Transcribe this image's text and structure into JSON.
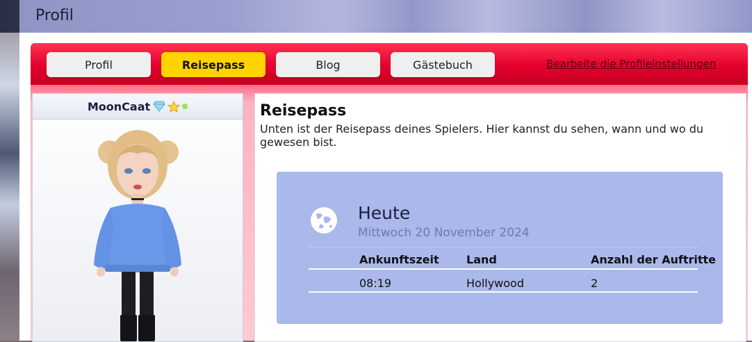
{
  "header": {
    "title": "Profil"
  },
  "nav": {
    "tabs": [
      {
        "label": "Profil",
        "active": false
      },
      {
        "label": "Reisepass",
        "active": true
      },
      {
        "label": "Blog",
        "active": false
      },
      {
        "label": "Gästebuch",
        "active": false
      }
    ],
    "edit_link": "Bearbeite die Profileinstellungen"
  },
  "avatar": {
    "username": "MoonCaat",
    "badges": [
      "diamond-icon",
      "star-icon",
      "online-status-icon"
    ]
  },
  "passport": {
    "title": "Reisepass",
    "description": "Unten ist der Reisepass deines Spielers. Hier kannst du sehen, wann und wo du gewesen bist.",
    "day": "Heute",
    "date": "Mittwoch 20 November 2024",
    "columns": [
      "Ankunftszeit",
      "Land",
      "Anzahl der Auftritte"
    ],
    "rows": [
      {
        "time": "08:19",
        "country": "Hollywood",
        "count": "2"
      }
    ]
  },
  "colors": {
    "nav_red": "#e4002e",
    "active_tab": "#ffd400",
    "passport_bg": "#aab8ea",
    "header_bar": "#aab2e8"
  }
}
